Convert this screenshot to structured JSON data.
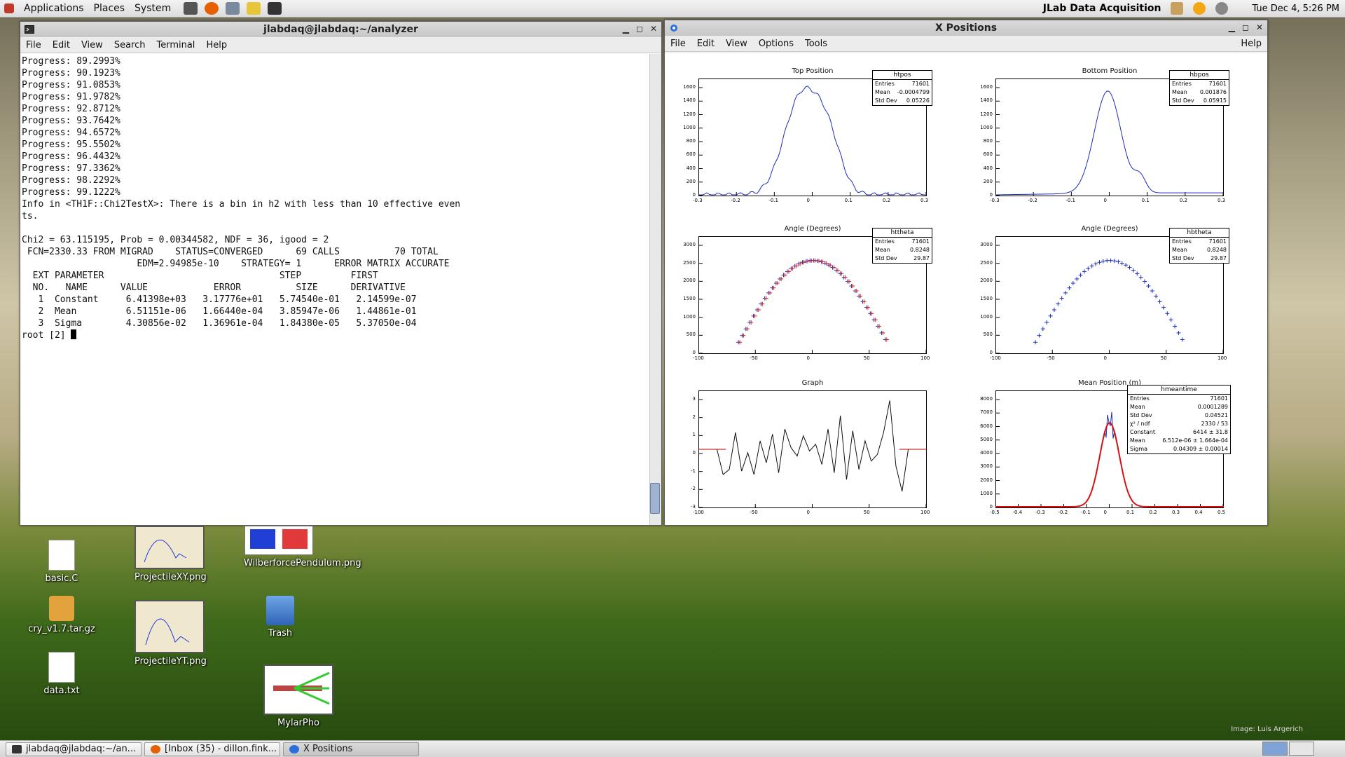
{
  "top_panel": {
    "menus": [
      "Applications",
      "Places",
      "System"
    ],
    "app_title": "JLab Data Acquisition",
    "clock": "Tue Dec  4,  5:26 PM"
  },
  "terminal": {
    "title": "jlabdaq@jlabdaq:~/analyzer",
    "menu": [
      "File",
      "Edit",
      "View",
      "Search",
      "Terminal",
      "Help"
    ],
    "lines": [
      "Progress: 89.2993%",
      "Progress: 90.1923%",
      "Progress: 91.0853%",
      "Progress: 91.9782%",
      "Progress: 92.8712%",
      "Progress: 93.7642%",
      "Progress: 94.6572%",
      "Progress: 95.5502%",
      "Progress: 96.4432%",
      "Progress: 97.3362%",
      "Progress: 98.2292%",
      "Progress: 99.1222%",
      "Info in <TH1F::Chi2TestX>: There is a bin in h2 with less than 10 effective even",
      "ts.",
      "",
      "Chi2 = 63.115195, Prob = 0.00344582, NDF = 36, igood = 2",
      " FCN=2330.33 FROM MIGRAD    STATUS=CONVERGED      69 CALLS          70 TOTAL",
      "                     EDM=2.94985e-10    STRATEGY= 1      ERROR MATRIX ACCURATE",
      "  EXT PARAMETER                                STEP         FIRST",
      "  NO.   NAME      VALUE            ERROR          SIZE      DERIVATIVE",
      "   1  Constant     6.41398e+03   3.17776e+01   5.74540e-01   2.14599e-07",
      "   2  Mean         6.51151e-06   1.66440e-04   3.85947e-06   1.44861e-01",
      "   3  Sigma        4.30856e-02   1.36961e-04   1.84380e-05   5.37050e-04"
    ],
    "prompt": "root [2] "
  },
  "xpositions": {
    "title": "X Positions",
    "menu": [
      "File",
      "Edit",
      "View",
      "Options",
      "Tools"
    ],
    "help": "Help",
    "plots": [
      {
        "title": "Top Position",
        "stat_name": "htpos",
        "stats": [
          [
            "Entries",
            "71601"
          ],
          [
            "Mean",
            "-0.0004799"
          ],
          [
            "Std Dev",
            "0.05226"
          ]
        ],
        "xticks": [
          "-0.3",
          "-0.2",
          "-0.1",
          "0",
          "0.1",
          "0.2",
          "0.3"
        ],
        "yticks": [
          "0",
          "200",
          "400",
          "600",
          "800",
          "1000",
          "1200",
          "1400",
          "1600"
        ]
      },
      {
        "title": "Bottom Position",
        "stat_name": "hbpos",
        "stats": [
          [
            "Entries",
            "71601"
          ],
          [
            "Mean",
            "0.001876"
          ],
          [
            "Std Dev",
            "0.05915"
          ]
        ],
        "xticks": [
          "-0.3",
          "-0.2",
          "-0.1",
          "0",
          "0.1",
          "0.2",
          "0.3"
        ],
        "yticks": [
          "0",
          "200",
          "400",
          "600",
          "800",
          "1000",
          "1200",
          "1400",
          "1600"
        ]
      },
      {
        "title": "Angle (Degrees)",
        "stat_name": "httheta",
        "stats": [
          [
            "Entries",
            "71601"
          ],
          [
            "Mean",
            "0.8248"
          ],
          [
            "Std Dev",
            "29.87"
          ]
        ],
        "xticks": [
          "-100",
          "-50",
          "0",
          "50",
          "100"
        ],
        "yticks": [
          "0",
          "500",
          "1000",
          "1500",
          "2000",
          "2500",
          "3000"
        ]
      },
      {
        "title": "Angle (Degrees)",
        "stat_name": "hbtheta",
        "stats": [
          [
            "Entries",
            "71601"
          ],
          [
            "Mean",
            "0.8248"
          ],
          [
            "Std Dev",
            "29.87"
          ]
        ],
        "xticks": [
          "-100",
          "-50",
          "0",
          "50",
          "100"
        ],
        "yticks": [
          "0",
          "500",
          "1000",
          "1500",
          "2000",
          "2500",
          "3000"
        ]
      },
      {
        "title": "Graph",
        "xticks": [
          "-100",
          "-50",
          "0",
          "50",
          "100"
        ],
        "yticks": [
          "-3",
          "-2",
          "-1",
          "0",
          "1",
          "2",
          "3"
        ]
      },
      {
        "title": "Mean Position (m)",
        "stat_name": "hmeantime",
        "stats": [
          [
            "Entries",
            "71601"
          ],
          [
            "Mean",
            "0.0001289"
          ],
          [
            "Std Dev",
            "0.04521"
          ],
          [
            "χ² / ndf",
            "2330 / 53"
          ],
          [
            "Constant",
            "6414 ± 31.8"
          ],
          [
            "Mean",
            "6.512e-06 ± 1.664e-04"
          ],
          [
            "Sigma",
            "0.04309 ± 0.00014"
          ]
        ],
        "xticks": [
          "-0.5",
          "-0.4",
          "-0.3",
          "-0.2",
          "-0.1",
          "0",
          "0.1",
          "0.2",
          "0.3",
          "0.4",
          "0.5"
        ],
        "yticks": [
          "0",
          "1000",
          "2000",
          "3000",
          "4000",
          "5000",
          "6000",
          "7000",
          "8000"
        ]
      }
    ]
  },
  "desktop_icons": [
    {
      "label": "basic.C",
      "icon": "text-file-icon"
    },
    {
      "label": "ProjectileXY.png",
      "icon": "image-file-icon"
    },
    {
      "label": "WilberforcePendulum.png",
      "icon": "image-file-icon"
    },
    {
      "label": "cry_v1.7.tar.gz",
      "icon": "archive-icon"
    },
    {
      "label": "ProjectileYT.png",
      "icon": "image-file-icon"
    },
    {
      "label": "Trash",
      "icon": "trash-icon"
    },
    {
      "label": "data.txt",
      "icon": "text-file-icon"
    },
    {
      "label": "MylarPho",
      "icon": "image-file-icon"
    }
  ],
  "credit": "Image: Luis Argerich",
  "taskbar": [
    {
      "label": "jlabdaq@jlabdaq:~/an...",
      "icon": "terminal-icon"
    },
    {
      "label": "[Inbox (35) - dillon.fink...",
      "icon": "firefox-icon"
    },
    {
      "label": "X Positions",
      "icon": "root-icon"
    }
  ]
}
